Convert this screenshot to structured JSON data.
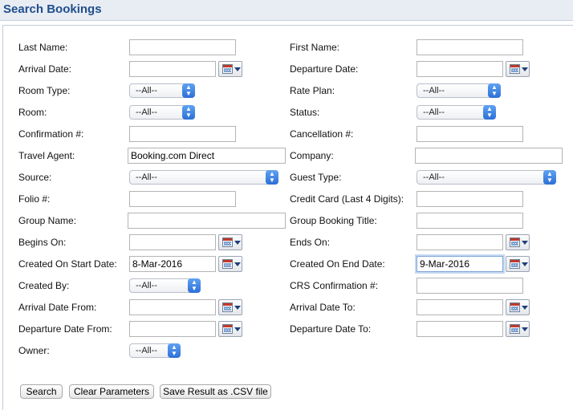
{
  "title": "Search Bookings",
  "labels": {
    "last_name": "Last Name:",
    "first_name": "First Name:",
    "arrival_date": "Arrival Date:",
    "departure_date": "Departure Date:",
    "room_type": "Room Type:",
    "rate_plan": "Rate Plan:",
    "room": "Room:",
    "status": "Status:",
    "confirmation": "Confirmation #:",
    "cancellation": "Cancellation #:",
    "travel_agent": "Travel Agent:",
    "company": "Company:",
    "source": "Source:",
    "guest_type": "Guest Type:",
    "folio": "Folio #:",
    "credit_card": "Credit Card (Last 4 Digits):",
    "group_name": "Group Name:",
    "group_booking_title": "Group Booking Title:",
    "begins_on": "Begins On:",
    "ends_on": "Ends On:",
    "created_start": "Created On Start Date:",
    "created_end": "Created On End Date:",
    "created_by": "Created By:",
    "crs_confirmation": "CRS Confirmation #:",
    "arrival_from": "Arrival Date From:",
    "arrival_to": "Arrival Date To:",
    "departure_from": "Departure Date From:",
    "departure_to": "Departure Date To:",
    "owner": "Owner:"
  },
  "values": {
    "last_name": "",
    "first_name": "",
    "arrival_date": "",
    "departure_date": "",
    "confirmation": "",
    "cancellation": "",
    "travel_agent": "Booking.com Direct",
    "company": "",
    "folio": "",
    "credit_card": "",
    "group_name": "",
    "group_booking_title": "",
    "begins_on": "",
    "ends_on": "",
    "created_start": "8-Mar-2016",
    "created_end": "9-Mar-2016",
    "crs_confirmation": "",
    "arrival_from": "",
    "arrival_to": "",
    "departure_from": "",
    "departure_to": ""
  },
  "selects": {
    "room_type": "--All--",
    "rate_plan": "--All--",
    "room": "--All--",
    "status": "--All--",
    "source": "--All--",
    "guest_type": "--All--",
    "created_by": "--All--",
    "owner": "--All--"
  },
  "buttons": {
    "search": "Search",
    "clear": "Clear Parameters",
    "save_csv": "Save Result as .CSV file"
  },
  "colors": {
    "title": "#1f4e8c",
    "select_knob": "#3b82f0"
  }
}
